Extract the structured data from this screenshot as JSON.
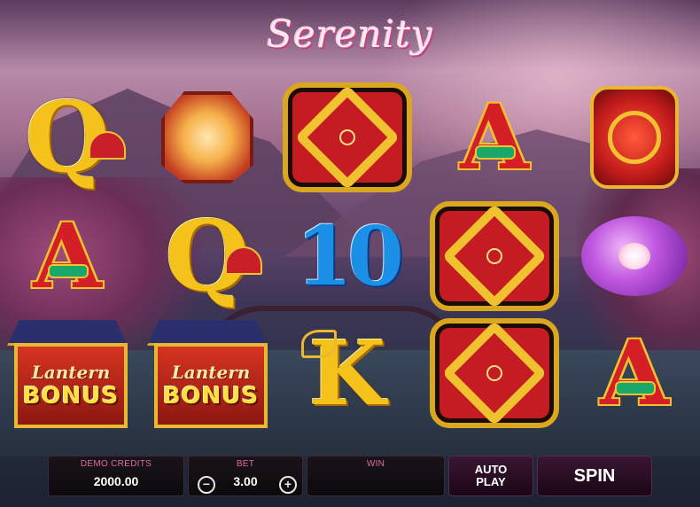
{
  "game": {
    "title": "Serenity"
  },
  "reels": [
    [
      {
        "symbol": "Q",
        "style": "gold",
        "extra": "fan"
      },
      {
        "symbol": "A",
        "style": "red",
        "extra": "gem"
      },
      {
        "symbol": "bonus",
        "line1": "Lantern",
        "line2": "BONUS"
      }
    ],
    [
      {
        "symbol": "lantern-hex"
      },
      {
        "symbol": "Q",
        "style": "gold",
        "extra": "fan"
      },
      {
        "symbol": "bonus",
        "line1": "Lantern",
        "line2": "BONUS"
      }
    ],
    [
      {
        "symbol": "knot"
      },
      {
        "symbol": "10",
        "style": "blue"
      },
      {
        "symbol": "K",
        "style": "gold",
        "extra": "dragon"
      }
    ],
    [
      {
        "symbol": "A",
        "style": "red",
        "extra": "gem"
      },
      {
        "symbol": "knot"
      },
      {
        "symbol": "knot"
      }
    ],
    [
      {
        "symbol": "lantern-red"
      },
      {
        "symbol": "lantern-purple"
      },
      {
        "symbol": "A",
        "style": "red",
        "extra": "gem"
      }
    ]
  ],
  "hud": {
    "credits_label": "DEMO CREDITS",
    "credits_value": "2000.00",
    "bet_label": "BET",
    "bet_value": "3.00",
    "bet_minus": "−",
    "bet_plus": "+",
    "win_label": "WIN",
    "autoplay_line1": "AUTO",
    "autoplay_line2": "PLAY",
    "spin_label": "SPIN"
  },
  "colors": {
    "accent_pink": "#e16aa6",
    "gold": "#f5c21c",
    "red": "#d41f26",
    "blue": "#1c8fe6"
  }
}
